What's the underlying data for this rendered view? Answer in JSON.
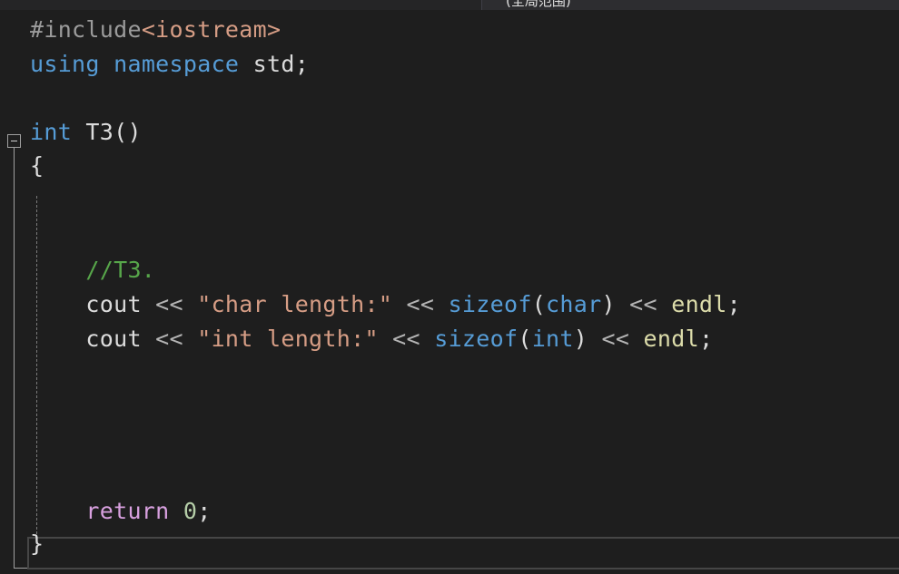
{
  "scope_header": {
    "label": "(全局范围)"
  },
  "code": {
    "line1": {
      "directive": "#include",
      "header": "<iostream>"
    },
    "line2": {
      "kw1": "using",
      "kw2": "namespace",
      "rest": " std;"
    },
    "line4": {
      "type": "int",
      "name": "T3",
      "parens": "()"
    },
    "line5": {
      "brace": "{"
    },
    "line9": {
      "comment": "//T3."
    },
    "line10": {
      "cout": "cout",
      "op1": "<<",
      "str": "\"char length:\"",
      "op2": "<<",
      "sizeof": "sizeof",
      "lp": "(",
      "type": "char",
      "rp": ")",
      "op3": "<<",
      "endl": "endl",
      "semi": ";"
    },
    "line11": {
      "cout": "cout",
      "op1": "<<",
      "str": "\"int length:\"",
      "op2": "<<",
      "sizeof": "sizeof",
      "lp": "(",
      "type": "int",
      "rp": ")",
      "op3": "<<",
      "endl": "endl",
      "semi": ";"
    },
    "line16": {
      "keyword": "return",
      "value": "0",
      "semi": ";"
    },
    "line17": {
      "brace": "}"
    }
  },
  "colors": {
    "background": "#1e1e1e",
    "keyword": "#569cd6",
    "preprocessor": "#9b9b9b",
    "string": "#d69d85",
    "comment": "#57a64a",
    "number": "#b5cea8",
    "control": "#d8a0df",
    "function": "#dcdcaa"
  }
}
